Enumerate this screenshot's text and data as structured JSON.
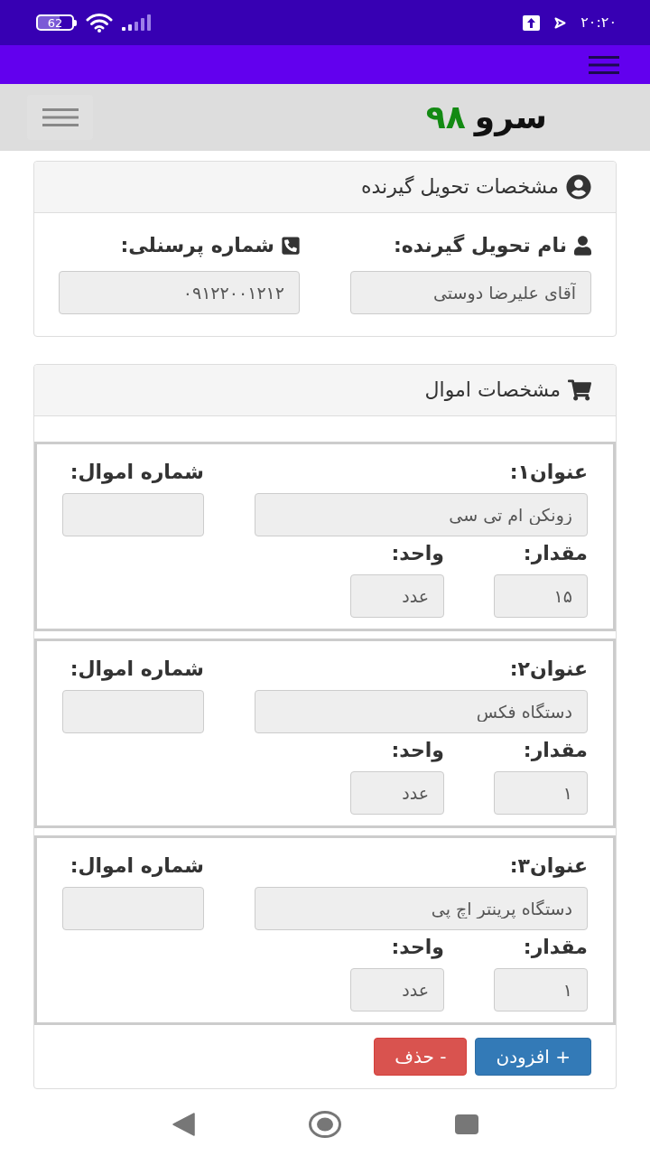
{
  "status_bar": {
    "battery": "62",
    "time": "۲۰:۲۰"
  },
  "header": {
    "logo_word": "سرو",
    "logo_number": "۹۸"
  },
  "recipient_card": {
    "title": "مشخصات تحویل گیرنده",
    "fields": [
      {
        "kind": "name",
        "label": "نام تحویل گیرنده:",
        "value": "آقای علیرضا دوستی"
      },
      {
        "kind": "phone",
        "label": "شماره پرسنلی:",
        "value": "۰۹۱۲۲۰۰۱۲۱۲"
      }
    ]
  },
  "assets_card": {
    "title": "مشخصات اموال",
    "items": [
      {
        "title_label": "عنوان۱:",
        "title_value": "زونکن ام تی سی",
        "asset_number_label": "شماره اموال:",
        "quantity_label": "مقدار:",
        "quantity_value": "۱۵",
        "unit_label": "واحد:",
        "unit_value": "عدد"
      },
      {
        "title_label": "عنوان۲:",
        "title_value": "دستگاه فکس",
        "asset_number_label": "شماره اموال:",
        "quantity_label": "مقدار:",
        "quantity_value": "۱",
        "unit_label": "واحد:",
        "unit_value": "عدد"
      },
      {
        "title_label": "عنوان۳:",
        "title_value": "دستگاه پرینتر اچ پی",
        "asset_number_label": "شماره اموال:",
        "quantity_label": "مقدار:",
        "quantity_value": "۱",
        "unit_label": "واحد:",
        "unit_value": "عدد"
      }
    ],
    "buttons": [
      {
        "kind": "add",
        "label": "+ افزودن"
      },
      {
        "kind": "remove",
        "label": "- حذف"
      }
    ]
  }
}
